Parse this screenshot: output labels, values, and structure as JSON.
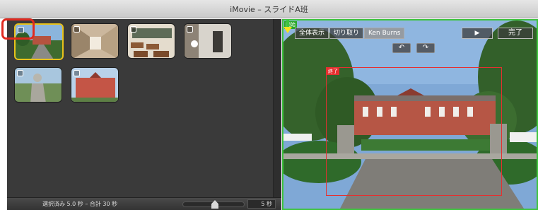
{
  "window": {
    "title": "iMovie – スライドA班"
  },
  "browser": {
    "thumbnails": [
      {
        "scene": "building-path",
        "selected": true
      },
      {
        "scene": "corridor",
        "selected": false
      },
      {
        "scene": "classroom",
        "selected": false
      },
      {
        "scene": "interior",
        "selected": false
      },
      {
        "scene": "statue",
        "selected": false
      },
      {
        "scene": "red-building",
        "selected": false
      }
    ],
    "status": "選択済み 5.0 秒 – 合計 30 秒",
    "zoom_value": "5 秒",
    "zoom_level": 0.5
  },
  "viewer": {
    "mode_buttons": [
      "全体表示",
      "切り取り",
      "Ken Burns"
    ],
    "active_mode": "Ken Burns",
    "play_label": "▶",
    "done_label": "完了",
    "crop_label": "終了",
    "start_label": "開始",
    "rotate_left": "↶",
    "rotate_right": "↷"
  },
  "colors": {
    "selection": "#e8c21a",
    "callout": "#e02a20",
    "start_frame": "#3fc43f",
    "end_frame": "#e53030"
  }
}
